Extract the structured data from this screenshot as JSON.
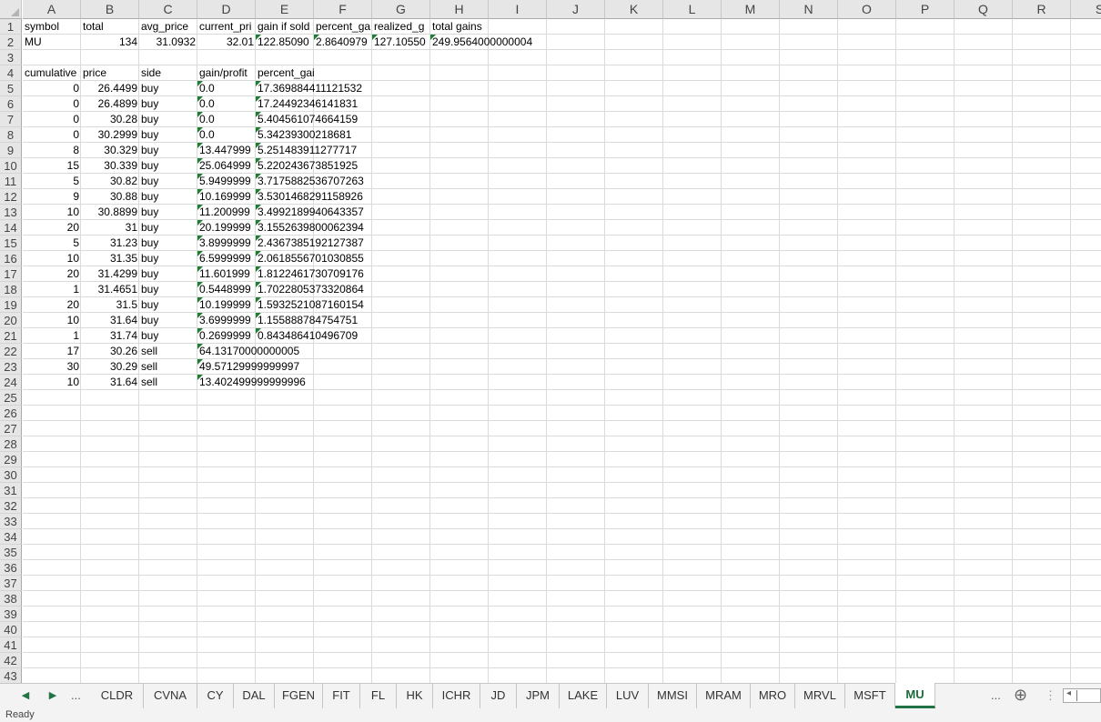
{
  "columns": [
    "A",
    "B",
    "C",
    "D",
    "E",
    "F",
    "G",
    "H",
    "I",
    "J",
    "K",
    "L",
    "M",
    "N",
    "O",
    "P",
    "Q",
    "R",
    "S"
  ],
  "rows": [
    "1",
    "2",
    "3",
    "4",
    "5",
    "6",
    "7",
    "8",
    "9",
    "10",
    "11",
    "12",
    "13",
    "14",
    "15",
    "16",
    "17",
    "18",
    "19",
    "20",
    "21",
    "22",
    "23",
    "24",
    "25",
    "26",
    "27",
    "28",
    "29",
    "30",
    "31",
    "32",
    "33",
    "34",
    "35",
    "36",
    "37",
    "38",
    "39",
    "40",
    "41",
    "42",
    "43"
  ],
  "header_row": {
    "a": "symbol",
    "b": "total",
    "c": "avg_price",
    "d": "current_pri",
    "e": "gain if sold",
    "f": "percent_ga",
    "g": "realized_g",
    "h": "total gains"
  },
  "summary_row": {
    "a": "MU",
    "b": "134",
    "c": "31.0932",
    "d": "32.01",
    "e": "122.85090",
    "f": "2.8640979",
    "g": "127.10550",
    "h": "249.9564000000004"
  },
  "table_headers": {
    "a": "cumulative",
    "b": "price",
    "c": "side",
    "d": "gain/profit",
    "e": "percent_gain"
  },
  "table_rows": [
    {
      "a": "0",
      "b": "26.4499",
      "c": "buy",
      "d": "0.0",
      "e": "17.369884411121532"
    },
    {
      "a": "0",
      "b": "26.4899",
      "c": "buy",
      "d": "0.0",
      "e": "17.24492346141831"
    },
    {
      "a": "0",
      "b": "30.28",
      "c": "buy",
      "d": "0.0",
      "e": "5.404561074664159"
    },
    {
      "a": "0",
      "b": "30.2999",
      "c": "buy",
      "d": "0.0",
      "e": "5.34239300218681"
    },
    {
      "a": "8",
      "b": "30.329",
      "c": "buy",
      "d": "13.447999",
      "e": "5.251483911277717"
    },
    {
      "a": "15",
      "b": "30.339",
      "c": "buy",
      "d": "25.064999",
      "e": "5.220243673851925"
    },
    {
      "a": "5",
      "b": "30.82",
      "c": "buy",
      "d": "5.9499999",
      "e": "3.7175882536707263"
    },
    {
      "a": "9",
      "b": "30.88",
      "c": "buy",
      "d": "10.169999",
      "e": "3.5301468291158926"
    },
    {
      "a": "10",
      "b": "30.8899",
      "c": "buy",
      "d": "11.200999",
      "e": "3.4992189940643357"
    },
    {
      "a": "20",
      "b": "31",
      "c": "buy",
      "d": "20.199999",
      "e": "3.1552639800062394"
    },
    {
      "a": "5",
      "b": "31.23",
      "c": "buy",
      "d": "3.8999999",
      "e": "2.4367385192127387"
    },
    {
      "a": "10",
      "b": "31.35",
      "c": "buy",
      "d": "6.5999999",
      "e": "2.0618556701030855"
    },
    {
      "a": "20",
      "b": "31.4299",
      "c": "buy",
      "d": "11.601999",
      "e": "1.8122461730709176"
    },
    {
      "a": "1",
      "b": "31.4651",
      "c": "buy",
      "d": "0.5448999",
      "e": "1.7022805373320864"
    },
    {
      "a": "20",
      "b": "31.5",
      "c": "buy",
      "d": "10.199999",
      "e": "1.5932521087160154"
    },
    {
      "a": "10",
      "b": "31.64",
      "c": "buy",
      "d": "3.6999999",
      "e": "1.155888784754751"
    },
    {
      "a": "1",
      "b": "31.74",
      "c": "buy",
      "d": "0.2699999",
      "e": "0.843486410496709"
    },
    {
      "a": "17",
      "b": "30.26",
      "c": "sell",
      "d": "64.13170000000005",
      "e": ""
    },
    {
      "a": "30",
      "b": "30.29",
      "c": "sell",
      "d": "49.57129999999997",
      "e": ""
    },
    {
      "a": "10",
      "b": "31.64",
      "c": "sell",
      "d": "13.402499999999996",
      "e": ""
    }
  ],
  "tabs": [
    "CLDR",
    "CVNA",
    "CY",
    "DAL",
    "FGEN",
    "FIT",
    "FL",
    "HK",
    "ICHR",
    "JD",
    "JPM",
    "LAKE",
    "LUV",
    "MMSI",
    "MRAM",
    "MRO",
    "MRVL",
    "MSFT",
    "MU"
  ],
  "active_tab": "MU",
  "tab_nav": {
    "prev": "◀",
    "next": "▶",
    "more_left": "...",
    "more_right": "...",
    "add": "⊕",
    "options": "⋮"
  },
  "status": "Ready",
  "colors": {
    "accent": "#217346",
    "comment_flag": "#1e7d32",
    "header_bg": "#e6e6e6"
  }
}
